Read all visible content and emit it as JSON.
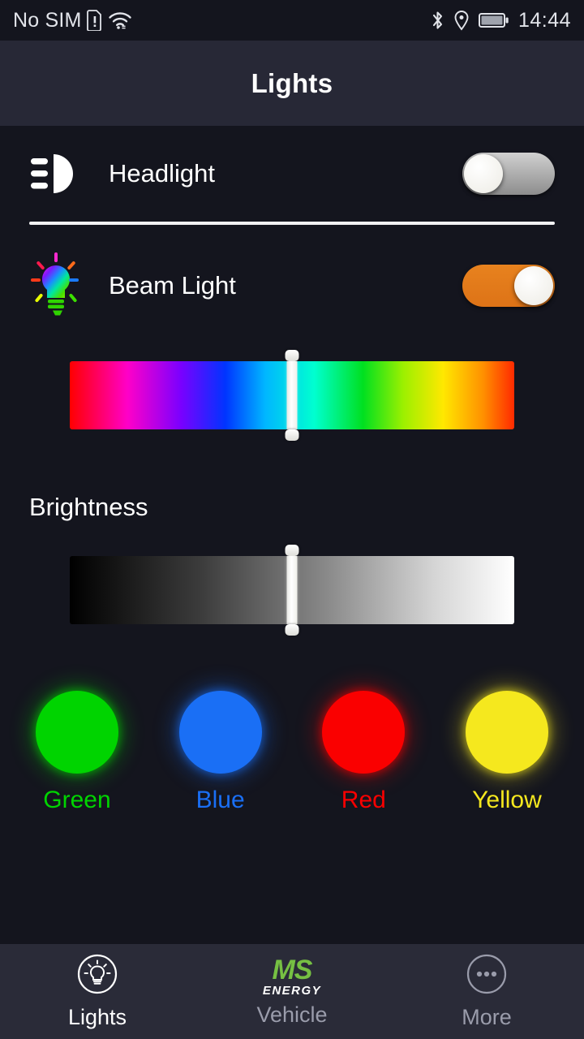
{
  "status_bar": {
    "carrier": "No SIM",
    "time": "14:44",
    "icons": [
      "sim-alert-icon",
      "wifi-icon",
      "bluetooth-icon",
      "location-icon",
      "battery-icon"
    ]
  },
  "header": {
    "title": "Lights"
  },
  "rows": {
    "headlight": {
      "label": "Headlight",
      "icon": "headlight-icon",
      "toggle_state": "off"
    },
    "beam_light": {
      "label": "Beam Light",
      "icon": "rgb-bulb-icon",
      "toggle_state": "on",
      "toggle_color": "#e8821e"
    }
  },
  "hue_slider": {
    "name": "color-hue-slider",
    "value_percent": 50
  },
  "brightness": {
    "label": "Brightness",
    "value_percent": 50
  },
  "presets": [
    {
      "label": "Green",
      "color": "#00d400"
    },
    {
      "label": "Blue",
      "color": "#1a6ff5"
    },
    {
      "label": "Red",
      "color": "#fa0000"
    },
    {
      "label": "Yellow",
      "color": "#f5e81e"
    }
  ],
  "bottom_nav": [
    {
      "label": "Lights",
      "icon": "bulb-circle-icon",
      "active": true
    },
    {
      "label": "Vehicle",
      "icon": "ms-energy-logo",
      "active": false,
      "brand_top": "MS",
      "brand_bottom": "ENERGY"
    },
    {
      "label": "More",
      "icon": "ellipsis-circle-icon",
      "active": false
    }
  ]
}
